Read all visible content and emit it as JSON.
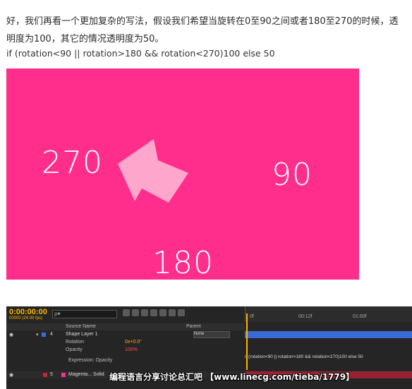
{
  "article": {
    "paragraph": "好，我们再看一个更加复杂的写法，假设我们希望当旋转在0至90之间或者180至270的时候，透明度为100，其它的情况透明度为50。",
    "code": "if (rotation<90 || rotation>180 && rotation<270)100 else 50"
  },
  "canvas": {
    "background": "#ff2d8c",
    "arrow_color": "#ffa6cc",
    "label_270": "270",
    "label_90": "90",
    "label_180": "180"
  },
  "after_effects": {
    "timecode": "0:00:00:00",
    "fps": "00000 (24.00 fps)",
    "search_placeholder": "ρ▾",
    "col_source_name": "Source Name",
    "col_parent": "Parent",
    "layer4_num": "4",
    "layer4_name": "Shape Layer 1",
    "layer4_parent": "None",
    "rotation_label": "Rotation",
    "rotation_value": "0x+0.0°",
    "opacity_label": "Opacity",
    "opacity_value": "100%",
    "expression_label": "Expression: Opacity",
    "expression_text": "if (rotation<90 || rotation>180 && rotation<270)100 else 50",
    "layer5_num": "5",
    "layer5_name": "Magenta... Solid",
    "ruler_0": "0f",
    "ruler_12": "00:12f",
    "ruler_1s": "01:00f",
    "accent": "#ffb400"
  },
  "watermark": "编程语言分享讨论总汇吧 【www.linecg.com/tieba/1779】"
}
